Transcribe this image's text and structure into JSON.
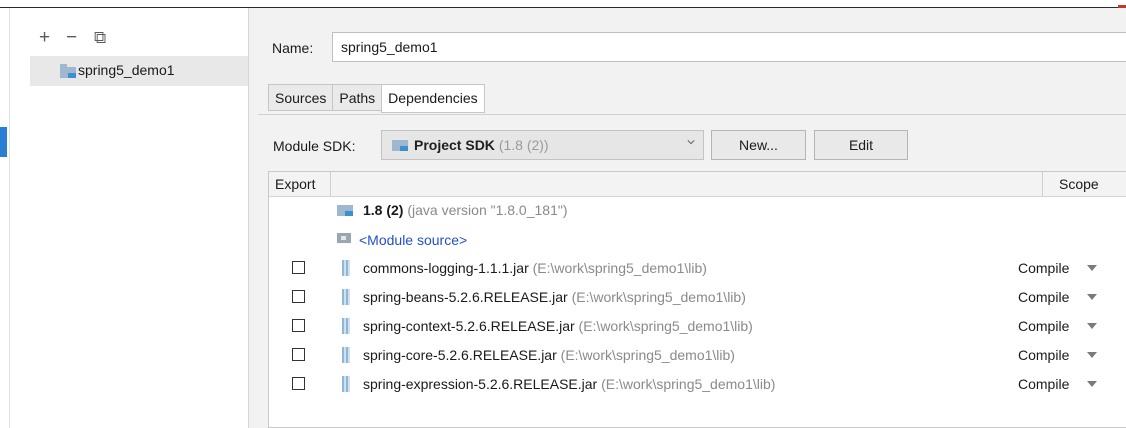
{
  "sidebar": {
    "add_glyph": "+",
    "remove_glyph": "−",
    "copy_glyph": "⧉",
    "module_name": "spring5_demo1"
  },
  "name_label": "Name:",
  "name_value": "spring5_demo1",
  "tabs": [
    "Sources",
    "Paths",
    "Dependencies"
  ],
  "sdk": {
    "label": "Module SDK:",
    "selected": "Project SDK",
    "selected_detail": "(1.8 (2))",
    "new_button": "New...",
    "edit_button": "Edit"
  },
  "table": {
    "col_export": "Export",
    "col_scope": "Scope",
    "sdk_row": {
      "name": "1.8 (2)",
      "detail": "(java version \"1.8.0_181\")"
    },
    "source_row": "<Module source>",
    "rows": [
      {
        "name": "commons-logging-1.1.1.jar",
        "path": "(E:\\work\\spring5_demo1\\lib)",
        "scope": "Compile"
      },
      {
        "name": "spring-beans-5.2.6.RELEASE.jar",
        "path": "(E:\\work\\spring5_demo1\\lib)",
        "scope": "Compile"
      },
      {
        "name": "spring-context-5.2.6.RELEASE.jar",
        "path": "(E:\\work\\spring5_demo1\\lib)",
        "scope": "Compile"
      },
      {
        "name": "spring-core-5.2.6.RELEASE.jar",
        "path": "(E:\\work\\spring5_demo1\\lib)",
        "scope": "Compile"
      },
      {
        "name": "spring-expression-5.2.6.RELEASE.jar",
        "path": "(E:\\work\\spring5_demo1\\lib)",
        "scope": "Compile"
      }
    ]
  },
  "colors": {
    "accent": "#2a7fd4",
    "selection": "#e8e8e8",
    "link": "#2250c8"
  }
}
